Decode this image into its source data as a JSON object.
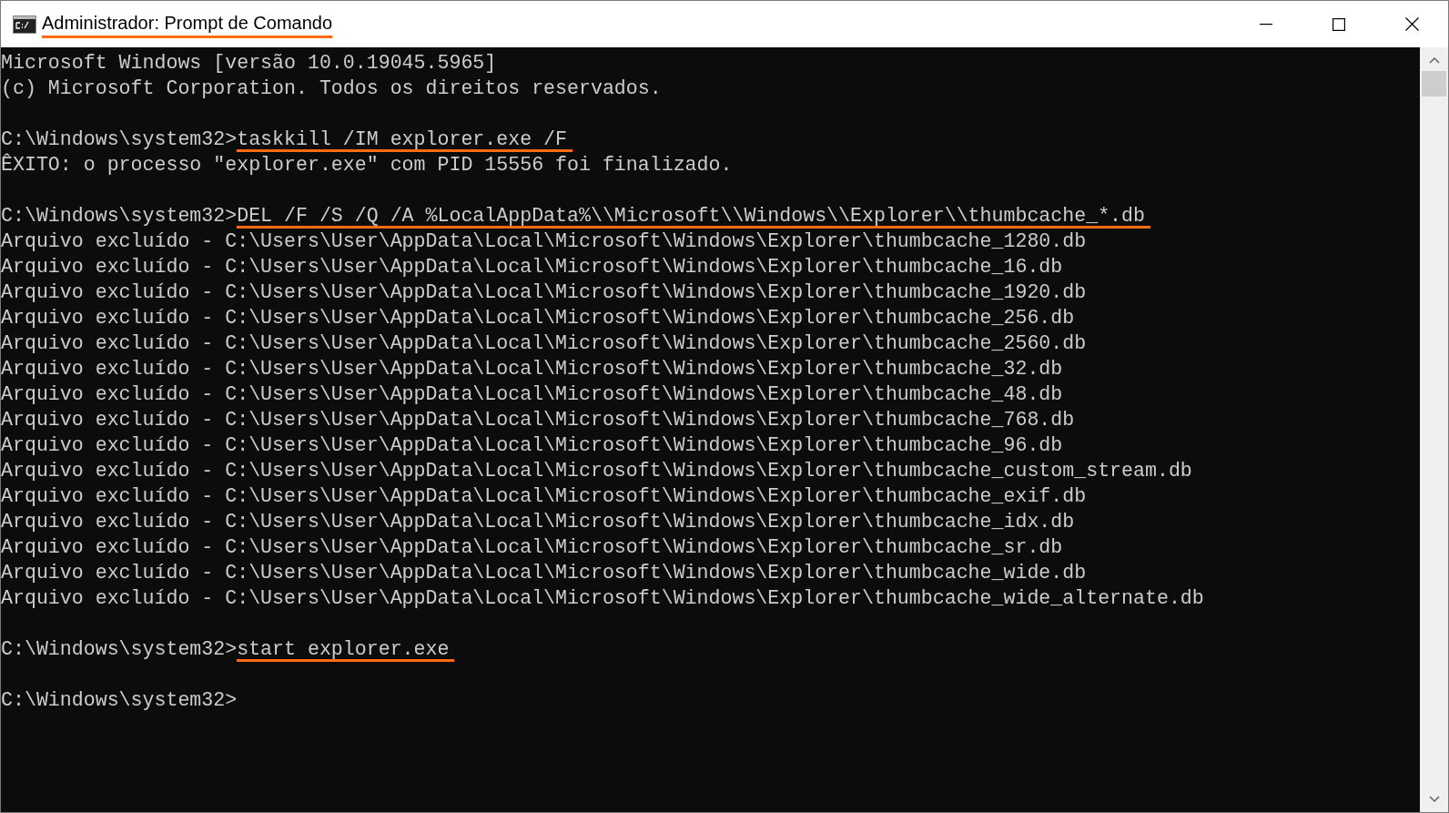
{
  "window": {
    "title": "Administrador: Prompt de Comando",
    "title_highlighted": true
  },
  "console": {
    "lines": [
      {
        "kind": "output",
        "text": "Microsoft Windows [versão 10.0.19045.5965]"
      },
      {
        "kind": "output",
        "text": "(c) Microsoft Corporation. Todos os direitos reservados."
      },
      {
        "kind": "blank"
      },
      {
        "kind": "prompt",
        "prompt": "C:\\Windows\\system32>",
        "command": "taskkill /IM explorer.exe /F",
        "highlighted": true
      },
      {
        "kind": "output",
        "text": "ÊXITO: o processo \"explorer.exe\" com PID 15556 foi finalizado."
      },
      {
        "kind": "blank"
      },
      {
        "kind": "prompt",
        "prompt": "C:\\Windows\\system32>",
        "command": "DEL /F /S /Q /A %LocalAppData%\\\\Microsoft\\\\Windows\\\\Explorer\\\\thumbcache_*.db",
        "highlighted": true
      },
      {
        "kind": "output",
        "text": "Arquivo excluído - C:\\Users\\User\\AppData\\Local\\Microsoft\\Windows\\Explorer\\thumbcache_1280.db"
      },
      {
        "kind": "output",
        "text": "Arquivo excluído - C:\\Users\\User\\AppData\\Local\\Microsoft\\Windows\\Explorer\\thumbcache_16.db"
      },
      {
        "kind": "output",
        "text": "Arquivo excluído - C:\\Users\\User\\AppData\\Local\\Microsoft\\Windows\\Explorer\\thumbcache_1920.db"
      },
      {
        "kind": "output",
        "text": "Arquivo excluído - C:\\Users\\User\\AppData\\Local\\Microsoft\\Windows\\Explorer\\thumbcache_256.db"
      },
      {
        "kind": "output",
        "text": "Arquivo excluído - C:\\Users\\User\\AppData\\Local\\Microsoft\\Windows\\Explorer\\thumbcache_2560.db"
      },
      {
        "kind": "output",
        "text": "Arquivo excluído - C:\\Users\\User\\AppData\\Local\\Microsoft\\Windows\\Explorer\\thumbcache_32.db"
      },
      {
        "kind": "output",
        "text": "Arquivo excluído - C:\\Users\\User\\AppData\\Local\\Microsoft\\Windows\\Explorer\\thumbcache_48.db"
      },
      {
        "kind": "output",
        "text": "Arquivo excluído - C:\\Users\\User\\AppData\\Local\\Microsoft\\Windows\\Explorer\\thumbcache_768.db"
      },
      {
        "kind": "output",
        "text": "Arquivo excluído - C:\\Users\\User\\AppData\\Local\\Microsoft\\Windows\\Explorer\\thumbcache_96.db"
      },
      {
        "kind": "output",
        "text": "Arquivo excluído - C:\\Users\\User\\AppData\\Local\\Microsoft\\Windows\\Explorer\\thumbcache_custom_stream.db"
      },
      {
        "kind": "output",
        "text": "Arquivo excluído - C:\\Users\\User\\AppData\\Local\\Microsoft\\Windows\\Explorer\\thumbcache_exif.db"
      },
      {
        "kind": "output",
        "text": "Arquivo excluído - C:\\Users\\User\\AppData\\Local\\Microsoft\\Windows\\Explorer\\thumbcache_idx.db"
      },
      {
        "kind": "output",
        "text": "Arquivo excluído - C:\\Users\\User\\AppData\\Local\\Microsoft\\Windows\\Explorer\\thumbcache_sr.db"
      },
      {
        "kind": "output",
        "text": "Arquivo excluído - C:\\Users\\User\\AppData\\Local\\Microsoft\\Windows\\Explorer\\thumbcache_wide.db"
      },
      {
        "kind": "output",
        "text": "Arquivo excluído - C:\\Users\\User\\AppData\\Local\\Microsoft\\Windows\\Explorer\\thumbcache_wide_alternate.db"
      },
      {
        "kind": "blank"
      },
      {
        "kind": "prompt",
        "prompt": "C:\\Windows\\system32>",
        "command": "start explorer.exe",
        "highlighted": true
      },
      {
        "kind": "blank"
      },
      {
        "kind": "prompt",
        "prompt": "C:\\Windows\\system32>"
      }
    ]
  }
}
